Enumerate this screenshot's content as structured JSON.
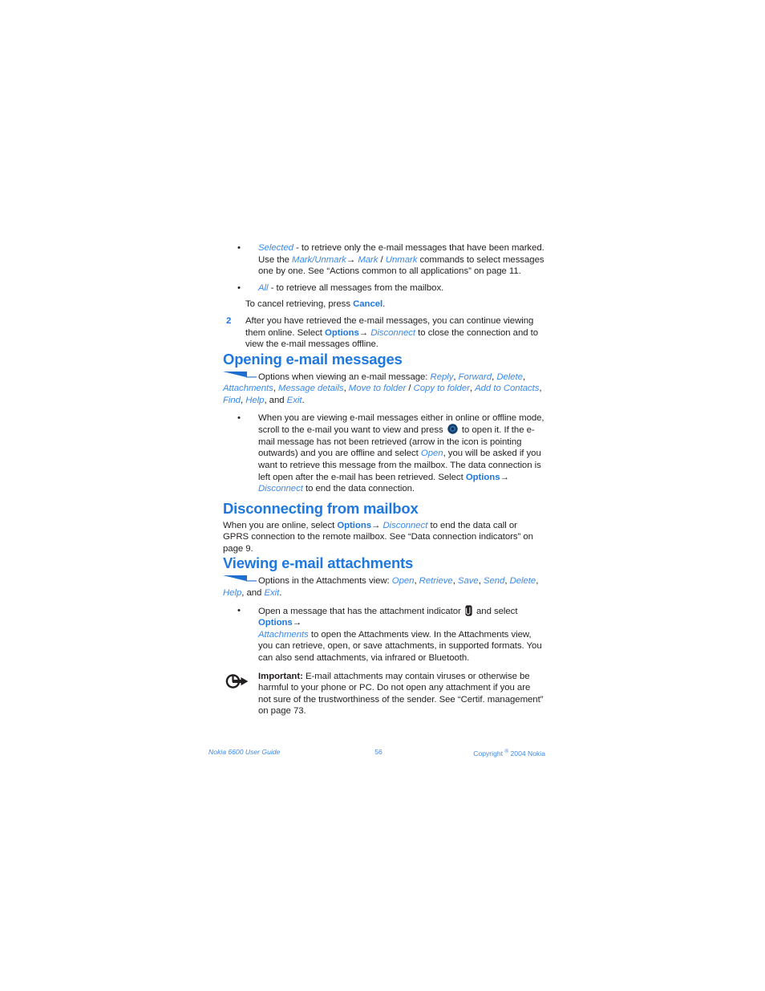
{
  "document": {
    "title": "Nokia 6600 User Guide",
    "page_number": "56",
    "accent_color": "#1f78e0",
    "link_color": "#3b8ae8",
    "body_color": "#231f20"
  },
  "bullets_top": [
    {
      "icon": "bullet-dot",
      "segments": [
        {
          "text": "Selected",
          "style": "blue-i"
        },
        {
          "text": " - to retrieve only the e-mail messages that have been marked. Use the ",
          "style": "plain"
        },
        {
          "text": "Mark/Unmark",
          "style": "blue-i"
        },
        {
          "text": "→ ",
          "style": "plain"
        },
        {
          "text": "Mark",
          "style": "blue-i"
        },
        {
          "text": " / ",
          "style": "plain"
        },
        {
          "text": "Unmark",
          "style": "blue-i"
        },
        {
          "text": " commands to select messages one by one. See “Actions common to all applications” on page 11.",
          "style": "plain"
        }
      ]
    },
    {
      "icon": "bullet-dot",
      "segments": [
        {
          "text": "All",
          "style": "blue-i"
        },
        {
          "text": " - to retrieve all messages from the mailbox.",
          "style": "plain"
        }
      ]
    }
  ],
  "cancel_line": {
    "before": "To cancel retrieving, press ",
    "action": "Cancel",
    "after": "."
  },
  "step_two": {
    "number": "2",
    "part1": "After you have retrieved the e-mail messages, you can continue viewing them online. Select ",
    "options_label": "Options",
    "arrow": "→",
    "disconnect_label": "Disconnect",
    "part2": " to close the connection and to view the e-mail messages offline."
  },
  "section_opening": {
    "heading": "Opening e-mail messages",
    "note_intro": "Options when viewing an e-mail message: ",
    "note_items": [
      "Reply",
      "Forward",
      "Delete",
      "Attachments",
      "Message details",
      "Move to folder",
      "Copy to folder",
      "Add to Contacts",
      "Find",
      "Help",
      "Exit"
    ],
    "bullet": {
      "part1": "When you are viewing e-mail messages either in online or offline mode, scroll to the e-mail you want to view and press ",
      "icon": "joystick-scroll-key-icon",
      "part2": " to open it. If the e-mail message has not been retrieved (arrow in the icon is pointing outwards) and you are offline and select ",
      "open_label": "Open",
      "part3": ", you will be asked if you want to retrieve this message from the mailbox. The data connection is left open after the e-mail has been retrieved. Select ",
      "options_label": "Options",
      "arrow": "→",
      "disconnect_label": "Disconnect",
      "part4": " to end the data connection."
    }
  },
  "section_disconnecting": {
    "heading": "Disconnecting from mailbox",
    "part1": "When you are online, select ",
    "options_label": "Options",
    "arrow": "→",
    "disconnect_label": "Disconnect",
    "part2": " to end the data call or GPRS connection to the remote mailbox. See “Data connection indicators” on page 9."
  },
  "section_attachments": {
    "heading": "Viewing e-mail attachments",
    "note_intro": "Options in the Attachments view: ",
    "note_items": [
      "Open",
      "Retrieve",
      "Save",
      "Send",
      "Delete",
      "Help",
      "Exit"
    ],
    "note_and": "and ",
    "bullet": {
      "part1": "Open a message that has the attachment indicator ",
      "icon": "paperclip-attachment-icon",
      "part2": " and select ",
      "options_label": "Options",
      "arrow": "→",
      "attachments_label": "Attachments",
      "part3": " to open the Attachments view. In the Attachments view, you can retrieve, open, or save attachments, in supported formats. You can also send attachments, via infrared or Bluetooth."
    },
    "important": {
      "icon": "important-arrow-icon",
      "label": "Important:",
      "text": " E-mail attachments may contain viruses or otherwise be harmful to your phone or PC. Do not open any attachment if you are not sure of the trustworthiness of the sender. See “Certif. management” on page 73."
    }
  },
  "footer": {
    "left": "Nokia 6600 User Guide",
    "center": "56",
    "right_before": "Copyright ",
    "right_symbol": "®",
    "right_after": " 2004 Nokia"
  }
}
